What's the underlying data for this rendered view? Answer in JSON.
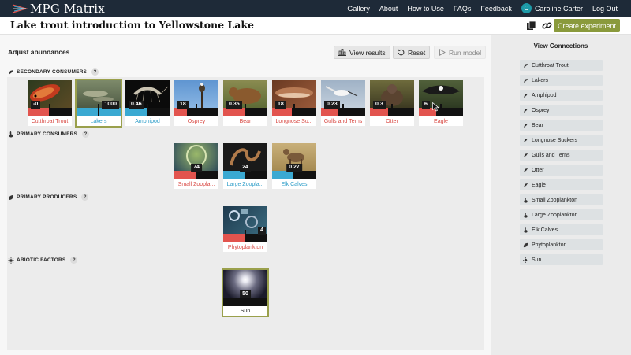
{
  "app": {
    "brand": "MPG Matrix"
  },
  "nav": {
    "links": [
      "Gallery",
      "About",
      "How to Use",
      "FAQs",
      "Feedback"
    ],
    "avatar_letter": "C",
    "user": "Caroline Carter",
    "logout": "Log Out"
  },
  "header": {
    "title": "Lake trout introduction to Yellowstone Lake",
    "create_label": "Create experiment",
    "icons": [
      "copy-icon",
      "link-icon"
    ]
  },
  "main": {
    "adjust_label": "Adjust abundances",
    "view_results": "View results",
    "reset": "Reset",
    "run_model": "Run model"
  },
  "sections": [
    {
      "title": "SECONDARY CONSUMERS",
      "help": "?",
      "cards": [
        {
          "label": "Cutthroat Trout",
          "value": "-0",
          "color": "red",
          "fill": 0.5
        },
        {
          "label": "Lakers",
          "value": "1000",
          "color": "blue",
          "fill": 1.0,
          "selected": true
        },
        {
          "label": "Amphipod",
          "value": "0.46",
          "color": "blue",
          "fill": 0.5
        },
        {
          "label": "Osprey",
          "value": "18",
          "color": "red",
          "fill": 0.28
        },
        {
          "label": "Bear",
          "value": "0.35",
          "color": "red",
          "fill": 0.5
        },
        {
          "label": "Longnose Su...",
          "value": "18",
          "color": "red",
          "fill": 0.45
        },
        {
          "label": "Gulls and Terns",
          "value": "0.23",
          "color": "red",
          "fill": 0.4
        },
        {
          "label": "Otter",
          "value": "0.3",
          "color": "red",
          "fill": 0.42
        },
        {
          "label": "Eagle",
          "value": "6",
          "color": "red",
          "fill": 0.4
        }
      ]
    },
    {
      "title": "PRIMARY CONSUMERS",
      "help": "?",
      "cards": [
        {
          "label": "Small Zooplа...",
          "value": "74",
          "color": "red",
          "fill": 0.5
        },
        {
          "label": "Large Zoopla...",
          "value": "24",
          "color": "blue",
          "fill": 0.5
        },
        {
          "label": "Elk Calves",
          "value": "0.27",
          "color": "blue",
          "fill": 0.5
        }
      ]
    },
    {
      "title": "PRIMARY PRODUCERS",
      "help": "?",
      "cards": [
        {
          "label": "Phytoplankton",
          "value": "4",
          "color": "red",
          "fill": 0.5
        }
      ]
    },
    {
      "title": "ABIOTIC FACTORS",
      "help": "?",
      "cards": [
        {
          "label": "Sun",
          "value": "50",
          "color": "dark",
          "fill": 0.5,
          "selected": true
        }
      ]
    }
  ],
  "connections": {
    "title": "View Connections",
    "items": [
      {
        "label": "Cutthroat Trout",
        "icon": "predator-icon"
      },
      {
        "label": "Lakers",
        "icon": "predator-icon"
      },
      {
        "label": "Amphipod",
        "icon": "predator-icon"
      },
      {
        "label": "Osprey",
        "icon": "predator-icon"
      },
      {
        "label": "Bear",
        "icon": "predator-icon"
      },
      {
        "label": "Longnose Suckers",
        "icon": "predator-icon"
      },
      {
        "label": "Gulls and Terns",
        "icon": "predator-icon"
      },
      {
        "label": "Otter",
        "icon": "predator-icon"
      },
      {
        "label": "Eagle",
        "icon": "predator-icon"
      },
      {
        "label": "Small Zooplankton",
        "icon": "rabbit-icon"
      },
      {
        "label": "Large Zooplankton",
        "icon": "rabbit-icon"
      },
      {
        "label": "Elk Calves",
        "icon": "rabbit-icon"
      },
      {
        "label": "Phytoplankton",
        "icon": "leaf-icon"
      },
      {
        "label": "Sun",
        "icon": "sun-icon"
      }
    ]
  },
  "colors": {
    "nav_bg": "#1e2a38",
    "accent": "#8a9a3c",
    "red": "#e2544e",
    "blue": "#3aa9d2"
  }
}
